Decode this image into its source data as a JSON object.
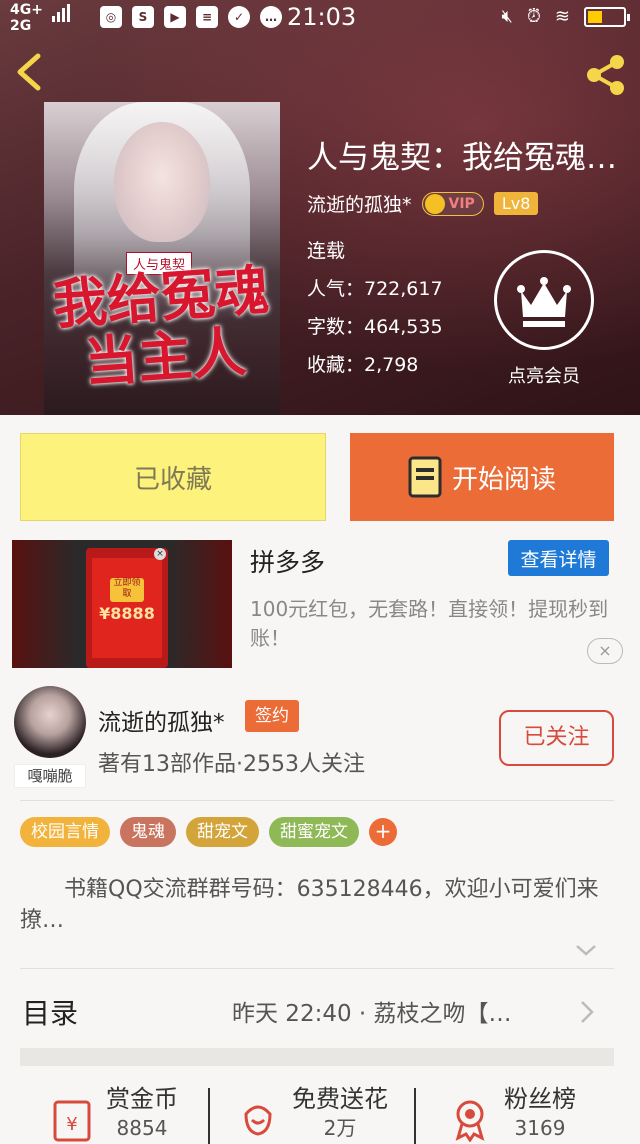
{
  "status_bar": {
    "network_top": "4G+",
    "network_bottom": "2G",
    "time": "21:03",
    "icons": [
      "compass-icon",
      "s-icon",
      "video-icon",
      "database-icon",
      "check-icon",
      "chat-icon"
    ],
    "right_icons": [
      "mute-icon",
      "alarm-icon",
      "wifi-icon",
      "battery-icon"
    ]
  },
  "book": {
    "title": "人与鬼契：我给冤魂…",
    "author": "流逝的孤独*",
    "vip_label": "VIP",
    "level": "Lv8",
    "status": "连载",
    "popularity": "人气：722,617",
    "word_count": "字数：464,535",
    "favorites": "收藏：2,798",
    "member_label": "点亮会员",
    "cover_tag": "人与鬼契",
    "cover_title": "我给冤魂当主人"
  },
  "actions": {
    "favorited_label": "已收藏",
    "read_label": "开始阅读"
  },
  "ad": {
    "title": "拼多多",
    "detail_label": "查看详情",
    "description": "100元红包，无套路！直接领！提现秒到账！",
    "stamp_text": "立即领取",
    "amount": "¥8888",
    "close_label": "×"
  },
  "author": {
    "name": "流逝的孤独*",
    "avatar_tag": "嘎嘣脆",
    "sign_label": "签约",
    "info": "著有13部作品·2553人关注",
    "follow_label": "已关注"
  },
  "tags": [
    {
      "label": "校园言情",
      "color": "#f2b33d"
    },
    {
      "label": "鬼魂",
      "color": "#c9745e"
    },
    {
      "label": "甜宠文",
      "color": "#d2a43a"
    },
    {
      "label": "甜蜜宠文",
      "color": "#8fb957"
    }
  ],
  "tag_add_label": "+",
  "intro": "书籍QQ交流群群号码：635128446，欢迎小可爱们来撩…",
  "catalog": {
    "label": "目录",
    "latest": "昨天 22:40 · 荔枝之吻【…"
  },
  "bottom_bar": {
    "items": [
      {
        "title": "赏金币",
        "value": "8854",
        "icon": "red-envelope-icon"
      },
      {
        "title": "免费送花",
        "value": "2万",
        "icon": "flower-icon"
      },
      {
        "title": "粉丝榜",
        "value": "3169",
        "icon": "medal-icon"
      }
    ]
  },
  "colors": {
    "accent_orange": "#ec6c38",
    "favorite_yellow": "#fdf27c",
    "follow_red": "#d74a3c",
    "detail_blue": "#1e7ad6"
  }
}
